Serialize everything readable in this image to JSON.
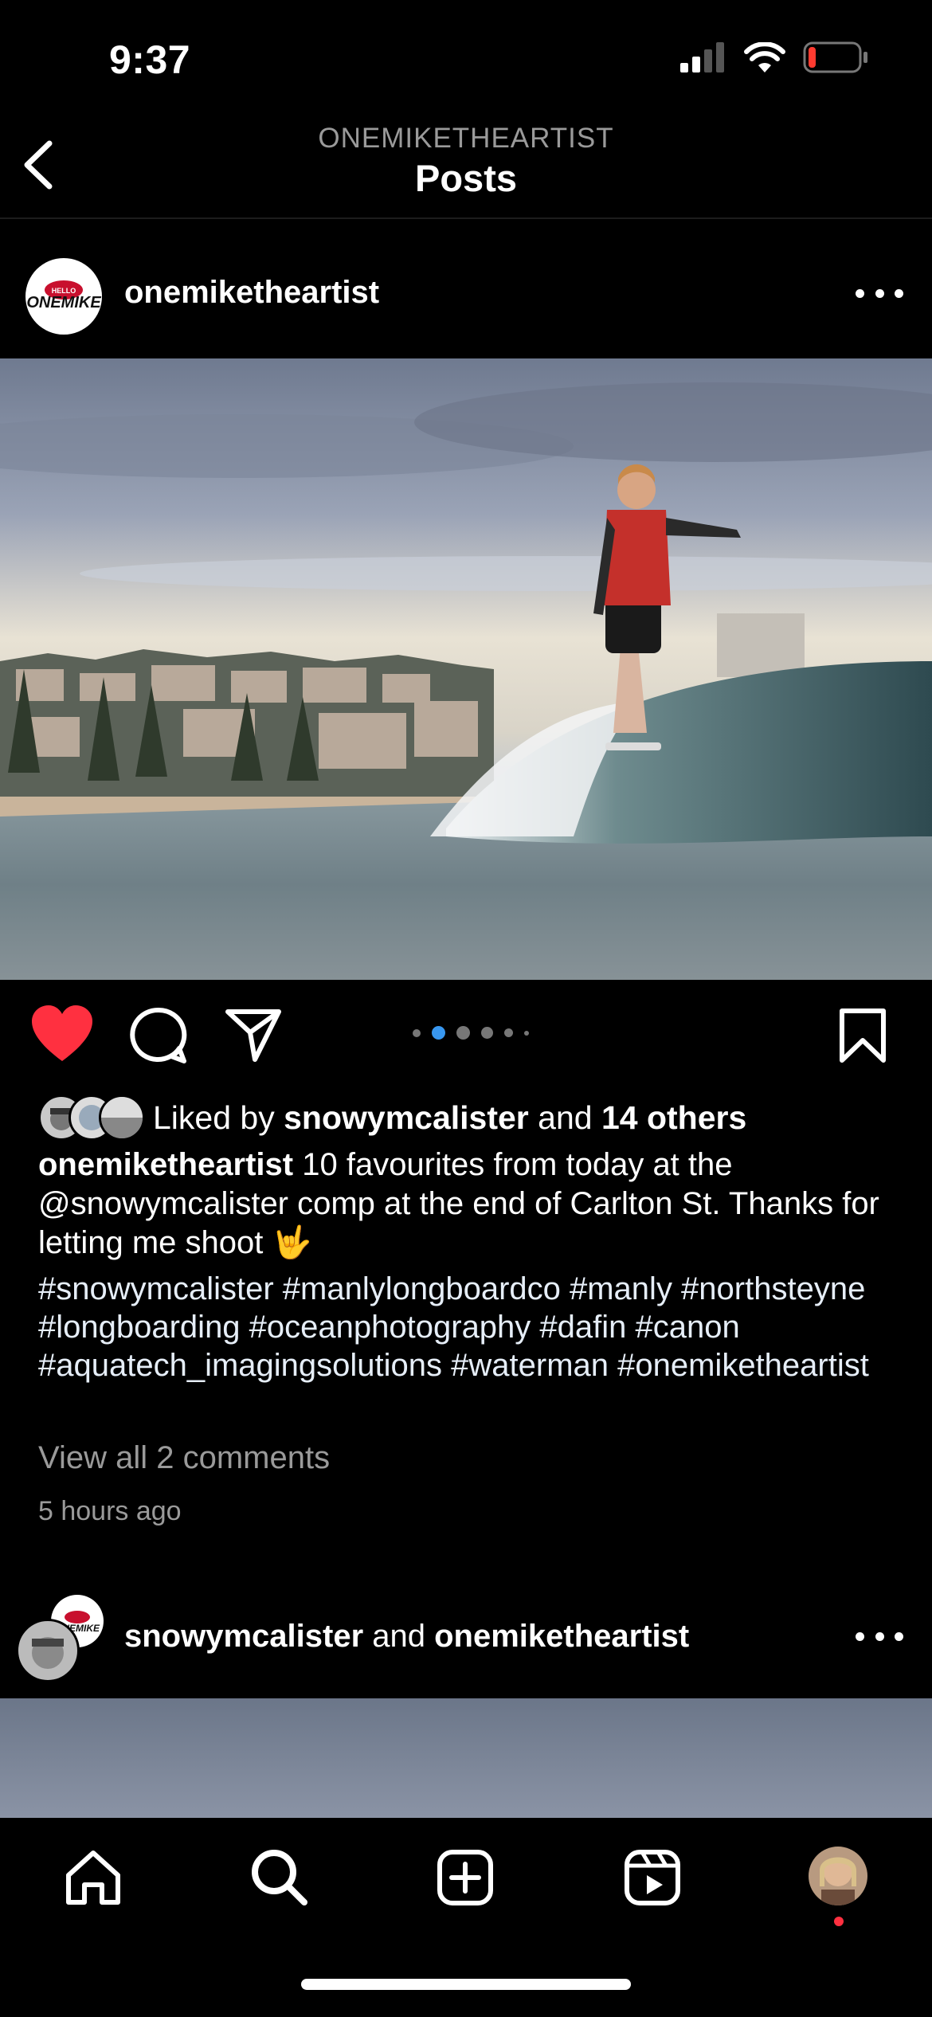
{
  "status_bar": {
    "time": "9:37",
    "battery_level_percent": 15
  },
  "nav": {
    "subtitle": "ONEMIKETHEARTIST",
    "title": "Posts"
  },
  "post": {
    "username": "onemiketheartist",
    "avatar_text": "ONEMIKE",
    "carousel": {
      "count": 5,
      "active_index": 1
    },
    "liked": true,
    "likes": {
      "prefix": "Liked by ",
      "user": "snowymcalister",
      "middle": " and ",
      "others": "14 others"
    },
    "caption": {
      "username": "onemiketheartist",
      "text": " 10 favourites from today at the @snowymcalister comp at the end of Carlton St. Thanks for letting me shoot 🤟"
    },
    "hashtags": "#snowymcalister #manlylongboardco #manly #northsteyne #longboarding #oceanphotography #dafin #canon #aquatech_imagingsolutions #waterman #onemiketheartist",
    "view_comments": "View all 2 comments",
    "time_ago": "5 hours ago"
  },
  "post2": {
    "user1": "snowymcalister",
    "connector": " and ",
    "user2": "onemiketheartist"
  },
  "colors": {
    "heart": "#ff3040",
    "carousel_active": "#3897f0",
    "background": "#000000"
  }
}
